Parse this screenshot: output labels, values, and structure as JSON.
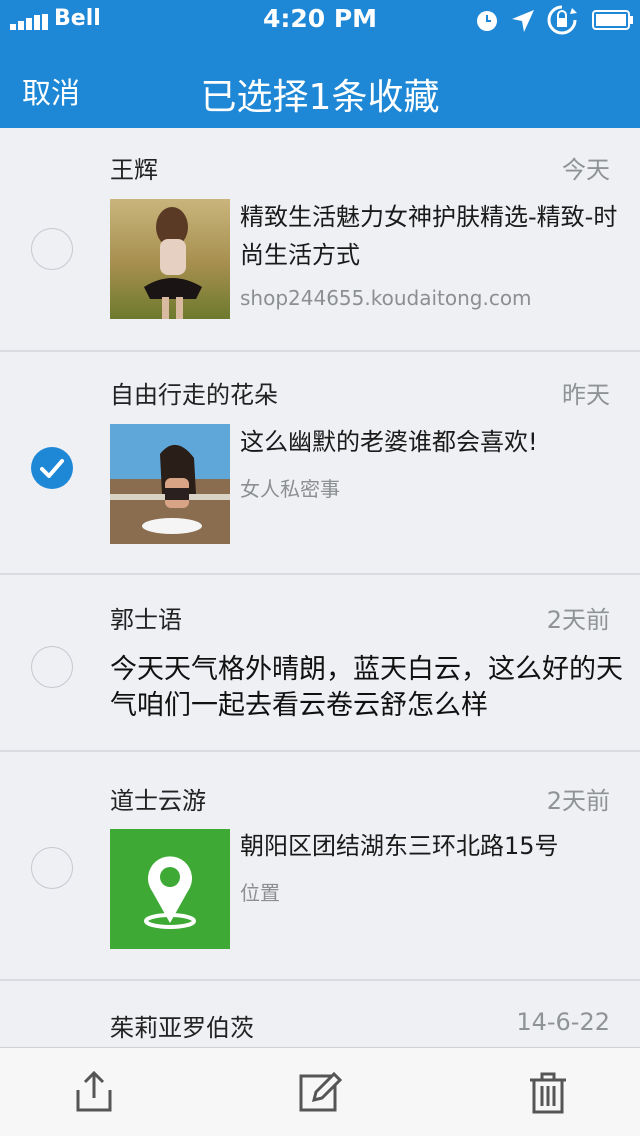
{
  "status_bar": {
    "carrier": "Bell",
    "time": "4:20 PM",
    "icons": [
      "signal-icon",
      "clock-icon",
      "location-icon",
      "rotation-lock-icon",
      "battery-icon"
    ]
  },
  "nav": {
    "cancel_label": "取消",
    "title": "已选择1条收藏"
  },
  "colors": {
    "accent": "#1f88d6",
    "list_bg": "#eff0f4",
    "location_tile": "#3eaa35"
  },
  "items": [
    {
      "name": "王辉",
      "date": "今天",
      "title": "精致生活魅力女神护肤精选-精致-时尚生活方式",
      "subtitle": "shop244655.koudaitong.com",
      "selected": false,
      "thumb": "photo-woman-in-skirt"
    },
    {
      "name": "自由行走的花朵",
      "date": "昨天",
      "title": "这么幽默的老婆谁都会喜欢!",
      "subtitle": "女人私密事",
      "selected": true,
      "thumb": "photo-woman-at-cafe"
    },
    {
      "name": "郭士语",
      "date": "2天前",
      "text": "今天天气格外晴朗，蓝天白云，这么好的天气咱们一起去看云卷云舒怎么样",
      "selected": false
    },
    {
      "name": "道士云游",
      "date": "2天前",
      "title": "朝阳区团结湖东三环北路15号",
      "subtitle": "位置",
      "selected": false,
      "thumb": "location-pin-icon"
    },
    {
      "name": "茱莉亚罗伯茨",
      "date": "14-6-22",
      "selected": false
    }
  ],
  "toolbar": {
    "icons": [
      "share-icon",
      "edit-icon",
      "trash-icon"
    ]
  }
}
